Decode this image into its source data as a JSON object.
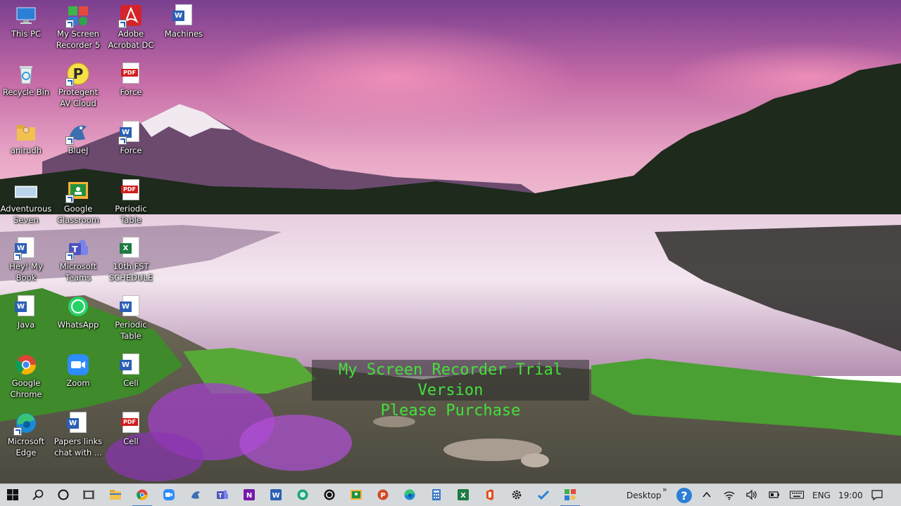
{
  "desktop": {
    "icons": [
      {
        "label": "This PC",
        "icon": "this-pc-icon"
      },
      {
        "label": "My Screen Recorder 5",
        "icon": "screen-recorder-icon"
      },
      {
        "label": "Adobe Acrobat DC",
        "icon": "acrobat-icon"
      },
      {
        "label": "Machines",
        "icon": "word-doc-icon"
      },
      {
        "label": "Recycle Bin",
        "icon": "recycle-bin-icon"
      },
      {
        "label": "Protegent AV Cloud",
        "icon": "protegent-icon"
      },
      {
        "label": "Force",
        "icon": "pdf-icon"
      },
      {
        "label": "anirudh",
        "icon": "user-folder-icon"
      },
      {
        "label": "BlueJ",
        "icon": "bluej-icon"
      },
      {
        "label": "Force",
        "icon": "word-doc-icon"
      },
      {
        "label": "Adventurous Seven",
        "icon": "image-file-icon"
      },
      {
        "label": "Google Classroom",
        "icon": "google-classroom-icon"
      },
      {
        "label": "Periodic Table",
        "icon": "pdf-icon"
      },
      {
        "label": "Hey! My Book",
        "icon": "word-doc-icon"
      },
      {
        "label": "Microsoft Teams",
        "icon": "teams-icon"
      },
      {
        "label": "10th FST SCHEDULE",
        "icon": "excel-doc-icon"
      },
      {
        "label": "Java",
        "icon": "word-doc-icon"
      },
      {
        "label": "WhatsApp",
        "icon": "whatsapp-icon"
      },
      {
        "label": "Periodic Table",
        "icon": "word-doc-icon"
      },
      {
        "label": "Google Chrome",
        "icon": "chrome-icon"
      },
      {
        "label": "Zoom",
        "icon": "zoom-icon"
      },
      {
        "label": "Cell",
        "icon": "word-doc-icon"
      },
      {
        "label": "Microsoft Edge",
        "icon": "edge-icon"
      },
      {
        "label": "Papers links chat with ...",
        "icon": "word-doc-icon"
      },
      {
        "label": "Cell",
        "icon": "pdf-icon"
      }
    ]
  },
  "watermark": {
    "line1": "My Screen Recorder Trial Version",
    "line2": "Please Purchase"
  },
  "taskbar": {
    "desktop_label": "Desktop",
    "overflow_glyph": "»",
    "language": "ENG",
    "time": "19:00",
    "accent_color": "#3a78c6"
  },
  "doc_badges": {
    "word": "W",
    "excel": "X",
    "pdf": "PDF"
  }
}
